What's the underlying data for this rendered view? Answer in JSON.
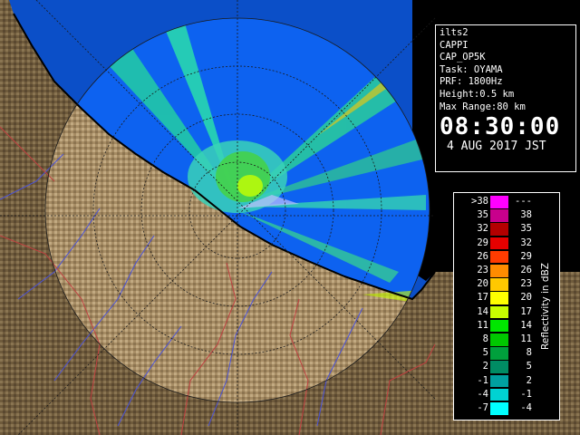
{
  "info": {
    "lines": [
      "ilts2",
      "CAPPI",
      "CAP_OP5K",
      "Task: OYAMA",
      "PRF: 1800Hz",
      "Height:0.5 km",
      "Max Range:80 km"
    ],
    "time": "08:30:00",
    "date": "4 AUG 2017 JST"
  },
  "legend": {
    "title": "Reflectivity in dBZ",
    "rows": [
      {
        "left": ">38",
        "right": "---",
        "color": "#ff00ff"
      },
      {
        "left": "35",
        "right": "38",
        "color": "#c8008c"
      },
      {
        "left": "32",
        "right": "35",
        "color": "#b40000"
      },
      {
        "left": "29",
        "right": "32",
        "color": "#e60000"
      },
      {
        "left": "26",
        "right": "29",
        "color": "#ff3c00"
      },
      {
        "left": "23",
        "right": "26",
        "color": "#ff8c00"
      },
      {
        "left": "20",
        "right": "23",
        "color": "#ffc800"
      },
      {
        "left": "17",
        "right": "20",
        "color": "#ffff00"
      },
      {
        "left": "14",
        "right": "17",
        "color": "#c8ff00"
      },
      {
        "left": "11",
        "right": "14",
        "color": "#00e600"
      },
      {
        "left": "8",
        "right": "11",
        "color": "#00c800"
      },
      {
        "left": "5",
        "right": "8",
        "color": "#00a03c"
      },
      {
        "left": "2",
        "right": "5",
        "color": "#008c64"
      },
      {
        "left": "-1",
        "right": "2",
        "color": "#00a0a0"
      },
      {
        "left": "-4",
        "right": "-1",
        "color": "#00d2d2"
      },
      {
        "left": "-7",
        "right": "-4",
        "color": "#00ffff"
      }
    ]
  },
  "colors": {
    "sea": "#0b57e0",
    "sea_edge": "#0032b4",
    "land": "#7a6646",
    "land_light": "#b9a079",
    "coast": "#000000",
    "river": "#4a52d8",
    "border": "#b83a3a",
    "ring": "#1a1a1a"
  }
}
